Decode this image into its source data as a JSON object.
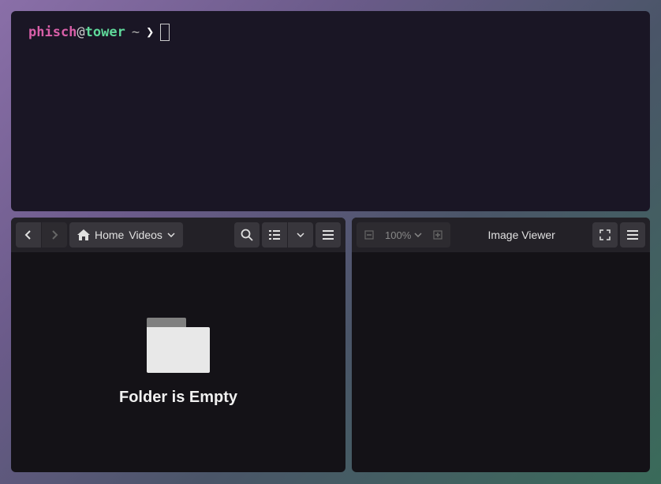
{
  "terminal": {
    "user": "phisch",
    "at": "@",
    "host": "tower",
    "path": "~",
    "prompt_symbol": "❯"
  },
  "file_manager": {
    "breadcrumb": {
      "home": "Home",
      "folder": "Videos"
    },
    "empty_message": "Folder is Empty"
  },
  "image_viewer": {
    "title": "Image Viewer",
    "zoom": "100%"
  }
}
